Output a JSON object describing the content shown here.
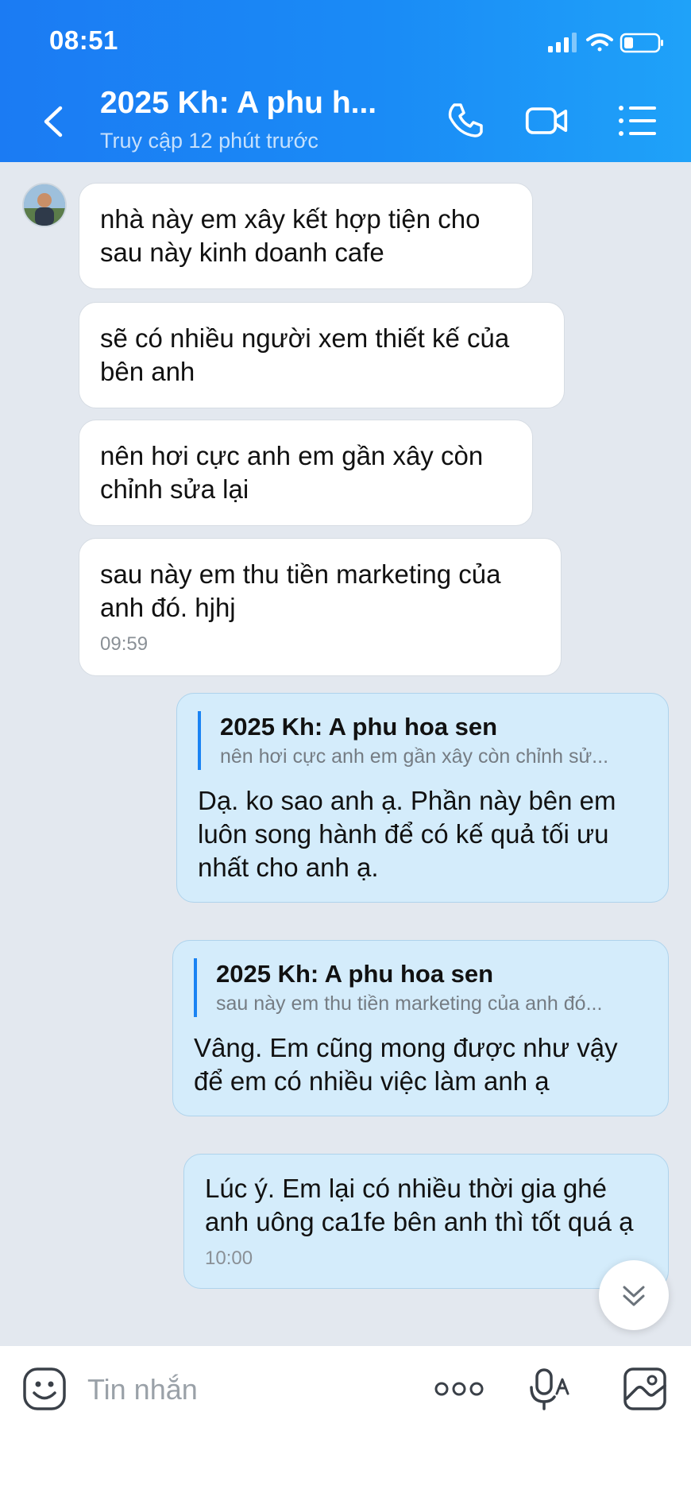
{
  "status_bar": {
    "time": "08:51"
  },
  "header": {
    "title": "2025 Kh: A phu h...",
    "subtitle": "Truy cập 12 phút trước"
  },
  "messages": [
    {
      "direction": "in",
      "text": "nhà này em xây kết hợp tiện cho sau này kinh doanh cafe"
    },
    {
      "direction": "in",
      "text": "sẽ có nhiều người xem thiết kế của bên anh"
    },
    {
      "direction": "in",
      "text": "nên hơi cực anh em gần xây còn chỉnh sửa lại"
    },
    {
      "direction": "in",
      "text": "sau này em thu tiền marketing của anh đó. hjhj",
      "time": "09:59"
    },
    {
      "direction": "out",
      "quote": {
        "author": "2025 Kh: A phu hoa sen",
        "text": "nên hơi cực anh em gần xây còn chỉnh sử..."
      },
      "text": "Dạ. ko sao anh ạ. Phần này bên em luôn song hành để có kế quả tối ưu nhất cho anh ạ."
    },
    {
      "direction": "out",
      "quote": {
        "author": "2025 Kh: A phu hoa sen",
        "text": "sau này em thu tiền marketing của anh đó..."
      },
      "text": "Vâng. Em cũng mong được như vậy để em có nhiều việc làm anh ạ"
    },
    {
      "direction": "out",
      "text": "Lúc ý. Em lại có nhiều thời gia ghé anh uông ca1fe bên anh thì tốt quá ạ",
      "time": "10:00"
    }
  ],
  "input": {
    "placeholder": "Tin nhắn"
  },
  "colors": {
    "header": "#1a8bf6",
    "outgoing_bubble": "#d4ecfb",
    "incoming_bubble": "#ffffff",
    "background": "#e3e8ef"
  }
}
